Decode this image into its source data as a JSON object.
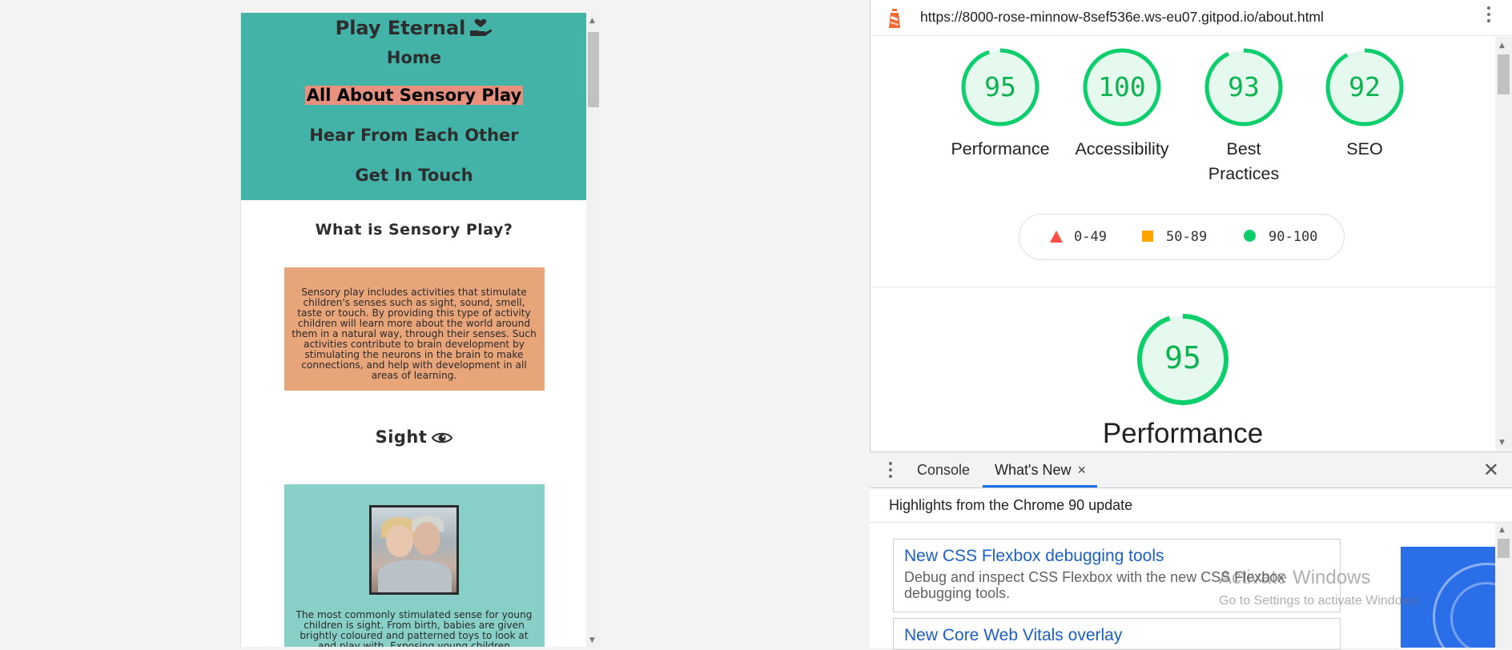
{
  "site": {
    "brand": "Play Eternal",
    "nav": [
      "Home",
      "All About Sensory Play",
      "Hear From Each Other",
      "Get In Touch"
    ],
    "active_nav": "All About Sensory Play",
    "what_title": "What is Sensory Play?",
    "what_text": "Sensory play includes activities that stimulate children's senses such as sight, sound, smell, taste or touch. By providing this type of activity children will learn more about the world around them in a natural way, through their senses. Such activities contribute to brain development by stimulating the neurons in the brain to make connections, and help with development in all areas of learning.",
    "sight_title": "Sight",
    "sight_text": "The most commonly stimulated sense for young children is sight. From birth, babies are given brightly coloured and patterned toys to look at and play with. Exposing young children"
  },
  "devtools": {
    "url": "https://8000-rose-minnow-8sef536e.ws-eu07.gitpod.io/about.html",
    "scores": [
      {
        "label": "Performance",
        "value": "95"
      },
      {
        "label": "Accessibility",
        "value": "100"
      },
      {
        "label": "Best Practices",
        "value": "93"
      },
      {
        "label": "SEO",
        "value": "92"
      }
    ],
    "legend": [
      {
        "range": "0-49",
        "color": "#ff4e42"
      },
      {
        "range": "50-89",
        "color": "#ffa400"
      },
      {
        "range": "90-100",
        "color": "#0cce6b"
      }
    ],
    "main_score": "95",
    "main_label": "Performance",
    "drawer": {
      "tabs": [
        "Console",
        "What's New"
      ],
      "close_tab": "×",
      "close_drawer": "✕",
      "highlights": "Highlights from the Chrome 90 update",
      "features": [
        {
          "title": "New CSS Flexbox debugging tools",
          "desc": "Debug and inspect CSS Flexbox with the new CSS Flexbox debugging tools."
        },
        {
          "title": "New Core Web Vitals overlay",
          "desc": ""
        }
      ]
    }
  },
  "watermark": {
    "line1": "Activate Windows",
    "line2": "Go to Settings to activate Windows."
  },
  "colors": {
    "header": "#43b3a7",
    "active_nav_bg": "#e8907e",
    "what_card": "#e8a57a",
    "sight_card": "#88cfc8",
    "score_green": "#0cce6b"
  }
}
